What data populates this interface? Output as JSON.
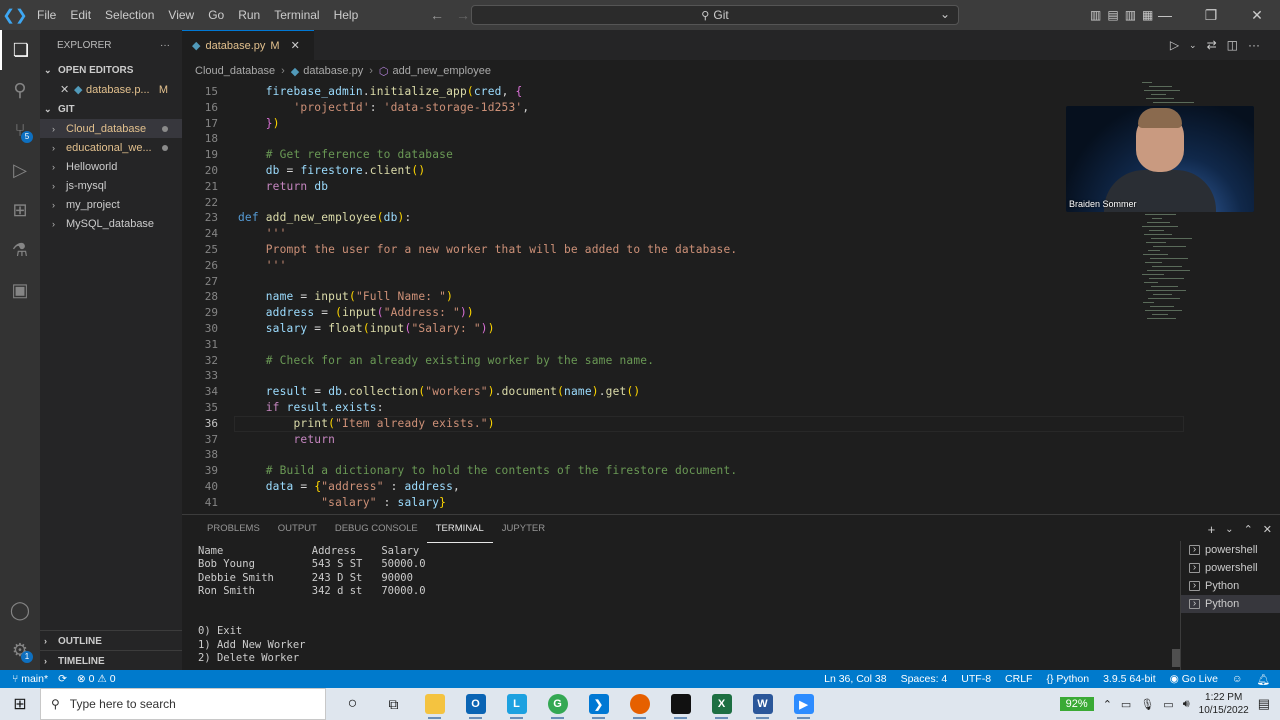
{
  "titlebar": {
    "menu": [
      "File",
      "Edit",
      "Selection",
      "View",
      "Go",
      "Run",
      "Terminal",
      "Help"
    ],
    "command_center": "Git"
  },
  "sidebar": {
    "header": "EXPLORER",
    "open_editors_label": "OPEN EDITORS",
    "open_editor_file": "database.p...",
    "open_editor_status": "M",
    "git_label": "GIT",
    "folders": [
      {
        "label": "Cloud_database",
        "modified": true,
        "selected": true
      },
      {
        "label": "educational_we...",
        "modified": true,
        "selected": false
      },
      {
        "label": "Helloworld",
        "modified": false,
        "selected": false
      },
      {
        "label": "js-mysql",
        "modified": false,
        "selected": false
      },
      {
        "label": "my_project",
        "modified": false,
        "selected": false
      },
      {
        "label": "MySQL_database",
        "modified": false,
        "selected": false
      }
    ],
    "outline_label": "OUTLINE",
    "timeline_label": "TIMELINE"
  },
  "activity_badges": {
    "source_control": "5",
    "manage": "1"
  },
  "editor": {
    "tab": {
      "label": "database.py",
      "status": "M"
    },
    "breadcrumbs": [
      "Cloud_database",
      "database.py",
      "add_new_employee"
    ],
    "current_line": 36,
    "lines": [
      {
        "n": 15,
        "html": "    <span class='vr'>firebase_admin</span>.<span class='fn'>initialize_app</span><span class='br1'>(</span><span class='vr'>cred</span>, <span class='br2'>{</span>"
      },
      {
        "n": 16,
        "html": "        <span class='st'>'projectId'</span>: <span class='st'>'data-storage-1d253'</span>,"
      },
      {
        "n": 17,
        "html": "    <span class='br2'>}</span><span class='br1'>)</span>"
      },
      {
        "n": 18,
        "html": ""
      },
      {
        "n": 19,
        "html": "    <span class='cm'># Get reference to database</span>"
      },
      {
        "n": 20,
        "html": "    <span class='vr'>db</span> = <span class='vr'>firestore</span>.<span class='fn'>client</span><span class='br1'>()</span>"
      },
      {
        "n": 21,
        "html": "    <span class='kc'>return</span> <span class='vr'>db</span>"
      },
      {
        "n": 22,
        "html": ""
      },
      {
        "n": 23,
        "html": "<span class='kw'>def</span> <span class='fn'>add_new_employee</span><span class='br1'>(</span><span class='vr'>db</span><span class='br1'>)</span>:"
      },
      {
        "n": 24,
        "html": "    <span class='st'>'''</span>"
      },
      {
        "n": 25,
        "html": "    <span class='st'>Prompt the user for a new worker that will be added to the database.</span>"
      },
      {
        "n": 26,
        "html": "    <span class='st'>'''</span>"
      },
      {
        "n": 27,
        "html": ""
      },
      {
        "n": 28,
        "html": "    <span class='vr'>name</span> = <span class='fn'>input</span><span class='br1'>(</span><span class='st'>\"Full Name: \"</span><span class='br1'>)</span>"
      },
      {
        "n": 29,
        "html": "    <span class='vr'>address</span> = <span class='br1'>(</span><span class='fn'>input</span><span class='br2'>(</span><span class='st'>\"Address: \"</span><span class='br2'>)</span><span class='br1'>)</span>"
      },
      {
        "n": 30,
        "html": "    <span class='vr'>salary</span> = <span class='fn'>float</span><span class='br1'>(</span><span class='fn'>input</span><span class='br2'>(</span><span class='st'>\"Salary: \"</span><span class='br2'>)</span><span class='br1'>)</span>"
      },
      {
        "n": 31,
        "html": ""
      },
      {
        "n": 32,
        "html": "    <span class='cm'># Check for an already existing worker by the same name.</span>"
      },
      {
        "n": 33,
        "html": ""
      },
      {
        "n": 34,
        "html": "    <span class='vr'>result</span> = <span class='vr'>db</span>.<span class='fn'>collection</span><span class='br1'>(</span><span class='st'>\"workers\"</span><span class='br1'>)</span>.<span class='fn'>document</span><span class='br1'>(</span><span class='vr'>name</span><span class='br1'>)</span>.<span class='fn'>get</span><span class='br1'>()</span>"
      },
      {
        "n": 35,
        "html": "    <span class='kc'>if</span> <span class='vr'>result</span>.<span class='vr'>exists</span>:"
      },
      {
        "n": 36,
        "html": "        <span class='fn'>print</span><span class='br1'>(</span><span class='st'>\"Item already exists.\"</span><span class='br1'>)</span>"
      },
      {
        "n": 37,
        "html": "        <span class='kc'>return</span>"
      },
      {
        "n": 38,
        "html": ""
      },
      {
        "n": 39,
        "html": "    <span class='cm'># Build a dictionary to hold the contents of the firestore document.</span>"
      },
      {
        "n": 40,
        "html": "    <span class='vr'>data</span> = <span class='br1'>{</span><span class='st'>\"address\"</span> : <span class='vr'>address</span>,"
      },
      {
        "n": 41,
        "html": "            <span class='st'>\"salary\"</span> : <span class='vr'>salary</span><span class='br1'>}</span>"
      }
    ]
  },
  "webcam": {
    "name": "Braiden Sommer"
  },
  "panel": {
    "tabs": [
      "PROBLEMS",
      "OUTPUT",
      "DEBUG CONSOLE",
      "TERMINAL",
      "JUPYTER"
    ],
    "active_tab": "TERMINAL",
    "terminal_lines": [
      "Name              Address    Salary",
      "Bob Young         543 S ST   50000.0",
      "Debbie Smith      243 D St   90000",
      "Ron Smith         342 d st   70000.0",
      "",
      "",
      "0) Exit",
      "1) Add New Worker",
      "2) Delete Worker"
    ],
    "terminals": [
      {
        "label": "powershell",
        "selected": false
      },
      {
        "label": "powershell",
        "selected": false
      },
      {
        "label": "Python",
        "selected": false
      },
      {
        "label": "Python",
        "selected": true
      }
    ]
  },
  "statusbar": {
    "branch": "main*",
    "problems": "⊗ 0 ⚠ 0",
    "position": "Ln 36, Col 38",
    "spaces": "Spaces: 4",
    "encoding": "UTF-8",
    "eol": "CRLF",
    "language": "Python",
    "interpreter": "3.9.5 64-bit",
    "golive": "Go Live"
  },
  "taskbar": {
    "search_placeholder": "Type here to search",
    "battery": "92%",
    "time": "1:22 PM",
    "date": "10/15/2022"
  },
  "colors": {
    "accent": "#007acc",
    "activity": "#333333",
    "sidebar": "#252526",
    "editor": "#1e1e1e"
  }
}
